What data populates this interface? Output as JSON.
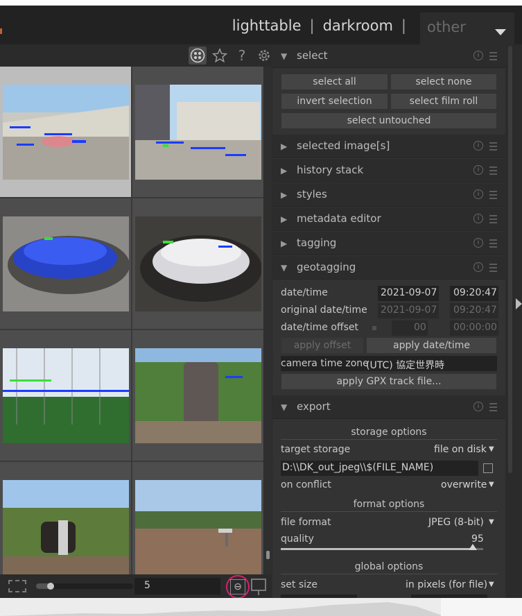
{
  "views": {
    "lighttable": "lighttable",
    "separator": "|",
    "darkroom": "darkroom",
    "other": "other"
  },
  "thumbnails": {
    "zoom_value": "5",
    "zoom_fraction": 0.15,
    "count": 8,
    "selected_index": 0
  },
  "modules": {
    "select": {
      "title": "select",
      "select_all": "select all",
      "select_none": "select none",
      "invert_selection": "invert selection",
      "select_film_roll": "select film roll",
      "select_untouched": "select untouched"
    },
    "collapsed": [
      "selected image[s]",
      "history stack",
      "styles",
      "metadata editor",
      "tagging"
    ],
    "geotagging": {
      "title": "geotagging",
      "datetime_label": "date/time",
      "datetime_date": "2021-09-07",
      "datetime_time": "09:20:47",
      "orig_label": "original date/time",
      "orig_date": "2021-09-07",
      "orig_time": "09:20:47",
      "offset_label": "date/time offset",
      "offset_days": "00",
      "offset_time": "00:00:00",
      "apply_offset": "apply offset",
      "apply_datetime": "apply date/time",
      "tz_label": "camera time zone",
      "tz_value": "(UTC) 協定世界時",
      "apply_gpx": "apply GPX track file..."
    },
    "export": {
      "title": "export",
      "storage_options": "storage options",
      "target_storage_label": "target storage",
      "target_storage_value": "file on disk",
      "path_value": "D:\\\\DK_out_jpeg\\\\$(FILE_NAME)",
      "on_conflict_label": "on conflict",
      "on_conflict_value": "overwrite",
      "format_options": "format options",
      "file_format_label": "file format",
      "file_format_value": "JPEG (8-bit)",
      "quality_label": "quality",
      "quality_value": "95",
      "global_options": "global options",
      "set_size_label": "set size",
      "set_size_value": "in pixels (for file)"
    }
  },
  "colors": {
    "accent_highlight": "#d6206d",
    "panel_bg": "#333333",
    "header_bg": "#222222"
  }
}
